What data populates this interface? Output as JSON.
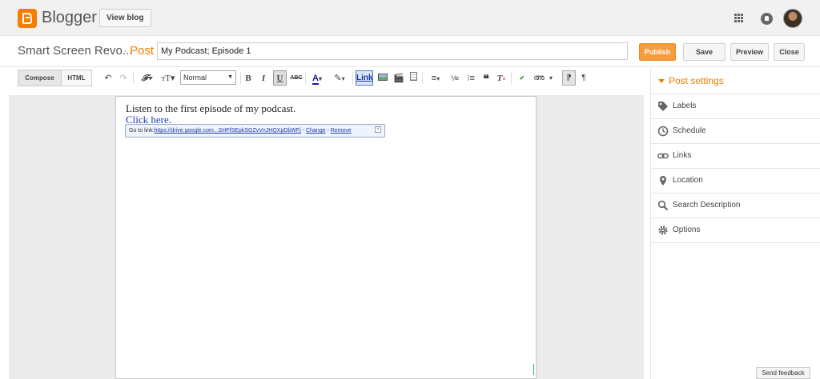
{
  "app": {
    "name": "Blogger",
    "view_blog": "View blog"
  },
  "header": {
    "blog_name": "Smart Screen Revo...",
    "separator": "·",
    "post_type": "Post",
    "title_value": "My Podcast; Episode 1",
    "buttons": {
      "publish": "Publish",
      "save": "Save",
      "preview": "Preview",
      "close": "Close"
    }
  },
  "toolbar": {
    "compose": "Compose",
    "html": "HTML",
    "font_size_value": "Normal",
    "bold": "B",
    "italic": "I",
    "underline": "U",
    "strikethrough": "ABC",
    "link": "Link"
  },
  "editor": {
    "body_text": "Listen to the first episode of my podcast.",
    "link_text": "Click here",
    "link_period": ".",
    "bubble": {
      "prefix": "Go to link:",
      "url": "https://drive.google.com...SHFfSEpkSGZvVnJHQXpDbWFj",
      "dash": " - ",
      "change": "Change",
      "sep": " - ",
      "remove": "Remove"
    }
  },
  "sidebar": {
    "title": "Post settings",
    "items": [
      {
        "label": "Labels",
        "icon": "tag-icon"
      },
      {
        "label": "Schedule",
        "icon": "clock-icon"
      },
      {
        "label": "Links",
        "icon": "chain-link-icon"
      },
      {
        "label": "Location",
        "icon": "map-pin-icon"
      },
      {
        "label": "Search Description",
        "icon": "magnifier-icon"
      },
      {
        "label": "Options",
        "icon": "gear-icon"
      }
    ]
  },
  "footer": {
    "send_feedback": "Send feedback"
  },
  "colors": {
    "accent": "#f57d00",
    "publish_bg": "#f79b3f",
    "link": "#1c3aa9"
  }
}
